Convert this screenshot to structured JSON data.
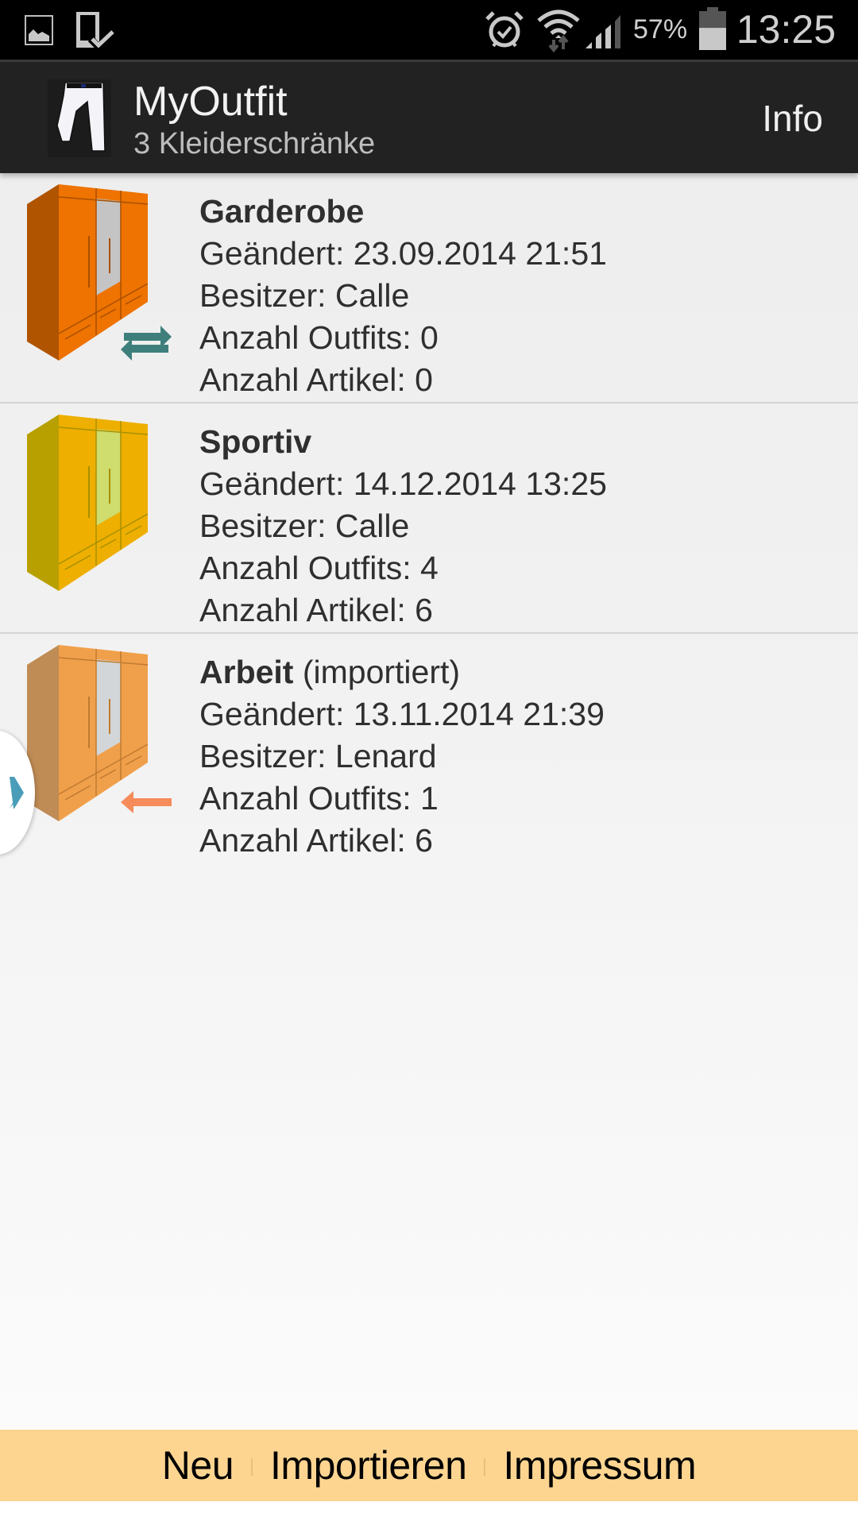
{
  "status_bar": {
    "left_icons": [
      "image-notification-icon",
      "download-complete-icon"
    ],
    "right_icons": [
      "alarm-icon",
      "wifi-icon",
      "signal-icon",
      "battery-icon"
    ],
    "battery_percent": "57%",
    "battery_level": 0.57,
    "time": "13:25"
  },
  "action_bar": {
    "title": "MyOutfit",
    "subtitle": "3 Kleiderschränke",
    "info_label": "Info"
  },
  "wardrobes": [
    {
      "name": "Garderobe",
      "suffix": "",
      "changed": "Geändert: 23.09.2014 21:51",
      "owner": "Besitzer: Calle",
      "outfits": "Anzahl Outfits: 0",
      "articles": "Anzahl Artikel: 0",
      "status_icon": "sync-arrows-icon",
      "colors": {
        "front": "#ee7300",
        "side": "#b05400",
        "mirror": "#c4c4c4",
        "line": "#a84f00",
        "icon": "#3e7f7c"
      }
    },
    {
      "name": "Sportiv",
      "suffix": "",
      "changed": "Geändert: 14.12.2014 13:25",
      "owner": "Besitzer: Calle",
      "outfits": "Anzahl Outfits: 4",
      "articles": "Anzahl Artikel: 6",
      "status_icon": "",
      "colors": {
        "front": "#eeaf00",
        "side": "#b8a000",
        "mirror": "#cfdc6e",
        "line": "#a89000"
      }
    },
    {
      "name": "Arbeit",
      "suffix": " (importiert)",
      "changed": "Geändert: 13.11.2014 21:39",
      "owner": "Besitzer: Lenard",
      "outfits": "Anzahl Outfits: 1",
      "articles": "Anzahl Artikel: 6",
      "status_icon": "import-arrow-icon",
      "colors": {
        "front": "#f0a04b",
        "side": "#c08c55",
        "mirror": "#d2d6d8",
        "line": "#c07a30",
        "icon": "#f58c5a"
      }
    }
  ],
  "bottom_bar": {
    "buttons": [
      "Neu",
      "Importieren",
      "Impressum"
    ],
    "background": "#fdd591"
  }
}
